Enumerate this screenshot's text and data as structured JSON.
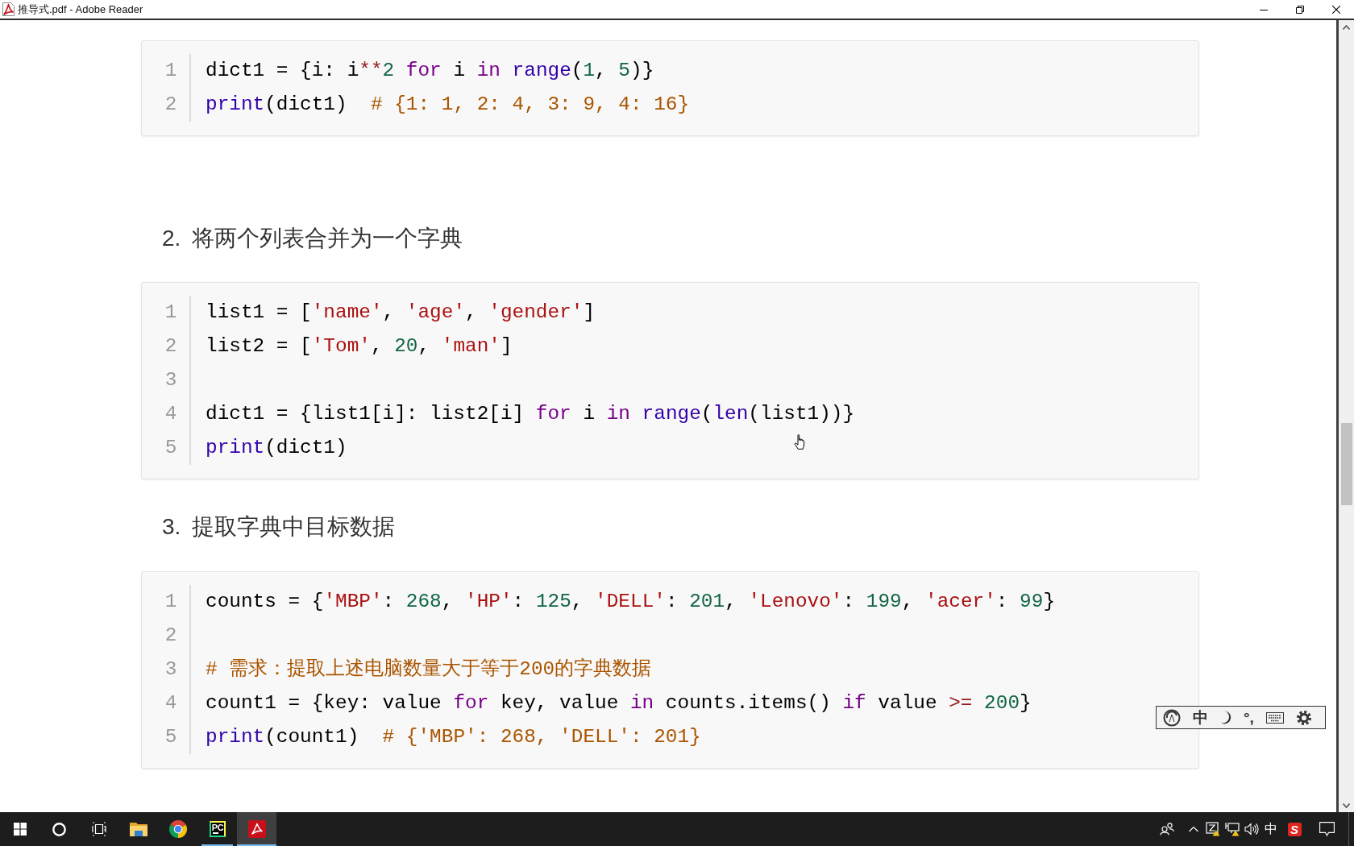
{
  "window": {
    "title": "推导式.pdf - Adobe Reader"
  },
  "document": {
    "blocks": [
      {
        "kind": "code",
        "lines": [
          {
            "number": "1",
            "tokens": [
              {
                "kind": "plain",
                "text": "dict1 = {i: i"
              },
              {
                "kind": "operator",
                "text": "**"
              },
              {
                "kind": "number",
                "text": "2 "
              },
              {
                "kind": "keyword",
                "text": "for"
              },
              {
                "kind": "plain",
                "text": " i "
              },
              {
                "kind": "keyword",
                "text": "in "
              },
              {
                "kind": "builtin",
                "text": "range"
              },
              {
                "kind": "plain",
                "text": "("
              },
              {
                "kind": "number",
                "text": "1"
              },
              {
                "kind": "plain",
                "text": ", "
              },
              {
                "kind": "number",
                "text": "5"
              },
              {
                "kind": "plain",
                "text": ")}"
              }
            ]
          },
          {
            "number": "2",
            "tokens": [
              {
                "kind": "builtin",
                "text": "print"
              },
              {
                "kind": "plain",
                "text": "(dict1)  "
              },
              {
                "kind": "comment",
                "text": "# {1: 1, 2: 4, 3: 9, 4: 16}"
              }
            ]
          }
        ]
      },
      {
        "kind": "heading",
        "number": "2.",
        "text": "将两个列表合并为一个字典"
      },
      {
        "kind": "code",
        "lines": [
          {
            "number": "1",
            "tokens": [
              {
                "kind": "plain",
                "text": "list1 = ["
              },
              {
                "kind": "string",
                "text": "'name'"
              },
              {
                "kind": "plain",
                "text": ", "
              },
              {
                "kind": "string",
                "text": "'age'"
              },
              {
                "kind": "plain",
                "text": ", "
              },
              {
                "kind": "string",
                "text": "'gender'"
              },
              {
                "kind": "plain",
                "text": "]"
              }
            ]
          },
          {
            "number": "2",
            "tokens": [
              {
                "kind": "plain",
                "text": "list2 = ["
              },
              {
                "kind": "string",
                "text": "'Tom'"
              },
              {
                "kind": "plain",
                "text": ", "
              },
              {
                "kind": "number",
                "text": "20"
              },
              {
                "kind": "plain",
                "text": ", "
              },
              {
                "kind": "string",
                "text": "'man'"
              },
              {
                "kind": "plain",
                "text": "]"
              }
            ]
          },
          {
            "number": "3"
          },
          {
            "number": "4",
            "tokens": [
              {
                "kind": "plain",
                "text": "dict1 = {list1[i]: list2[i] "
              },
              {
                "kind": "keyword",
                "text": "for"
              },
              {
                "kind": "plain",
                "text": " i "
              },
              {
                "kind": "keyword",
                "text": "in "
              },
              {
                "kind": "builtin",
                "text": "range"
              },
              {
                "kind": "plain",
                "text": "("
              },
              {
                "kind": "builtin",
                "text": "len"
              },
              {
                "kind": "plain",
                "text": "(list1))}"
              }
            ]
          },
          {
            "number": "5",
            "tokens": [
              {
                "kind": "builtin",
                "text": "print"
              },
              {
                "kind": "plain",
                "text": "(dict1)"
              }
            ]
          }
        ]
      },
      {
        "kind": "heading",
        "number": "3.",
        "text": "提取字典中目标数据"
      },
      {
        "kind": "code",
        "lines": [
          {
            "number": "1",
            "tokens": [
              {
                "kind": "plain",
                "text": "counts = {"
              },
              {
                "kind": "string",
                "text": "'MBP'"
              },
              {
                "kind": "plain",
                "text": ": "
              },
              {
                "kind": "number",
                "text": "268"
              },
              {
                "kind": "plain",
                "text": ", "
              },
              {
                "kind": "string",
                "text": "'HP'"
              },
              {
                "kind": "plain",
                "text": ": "
              },
              {
                "kind": "number",
                "text": "125"
              },
              {
                "kind": "plain",
                "text": ", "
              },
              {
                "kind": "string",
                "text": "'DELL'"
              },
              {
                "kind": "plain",
                "text": ": "
              },
              {
                "kind": "number",
                "text": "201"
              },
              {
                "kind": "plain",
                "text": ", "
              },
              {
                "kind": "string",
                "text": "'Lenovo'"
              },
              {
                "kind": "plain",
                "text": ": "
              },
              {
                "kind": "number",
                "text": "199"
              },
              {
                "kind": "plain",
                "text": ", "
              },
              {
                "kind": "string",
                "text": "'acer'"
              },
              {
                "kind": "plain",
                "text": ": "
              },
              {
                "kind": "number",
                "text": "99"
              },
              {
                "kind": "plain",
                "text": "}"
              }
            ]
          },
          {
            "number": "2"
          },
          {
            "number": "3",
            "tokens": [
              {
                "kind": "comment",
                "text": "# 需求：提取上述电脑数量大于等于200的字典数据"
              }
            ]
          },
          {
            "number": "4",
            "tokens": [
              {
                "kind": "plain",
                "text": "count1 = {key: value "
              },
              {
                "kind": "keyword",
                "text": "for"
              },
              {
                "kind": "plain",
                "text": " key, value "
              },
              {
                "kind": "keyword",
                "text": "in"
              },
              {
                "kind": "plain",
                "text": " counts.items() "
              },
              {
                "kind": "keyword",
                "text": "if"
              },
              {
                "kind": "plain",
                "text": " value "
              },
              {
                "kind": "operator",
                "text": ">= "
              },
              {
                "kind": "number",
                "text": "200"
              },
              {
                "kind": "plain",
                "text": "}"
              }
            ]
          },
          {
            "number": "5",
            "tokens": [
              {
                "kind": "builtin",
                "text": "print"
              },
              {
                "kind": "plain",
                "text": "(count1)  "
              },
              {
                "kind": "comment",
                "text": "# {'MBP': 268, 'DELL': 201}"
              }
            ]
          }
        ]
      }
    ]
  },
  "ime_toolbar": {
    "mode": "中",
    "punctuation": "°,"
  },
  "taskbar": {
    "apps": [
      {
        "kind": "file-explorer",
        "running": false,
        "selected": false
      },
      {
        "kind": "browser",
        "running": false,
        "selected": false
      },
      {
        "kind": "ide",
        "label": "PC",
        "running": true,
        "selected": false
      },
      {
        "kind": "pdf-reader",
        "running": true,
        "selected": true
      }
    ],
    "tray": {
      "language": "中",
      "input_method_badge": "S"
    }
  }
}
